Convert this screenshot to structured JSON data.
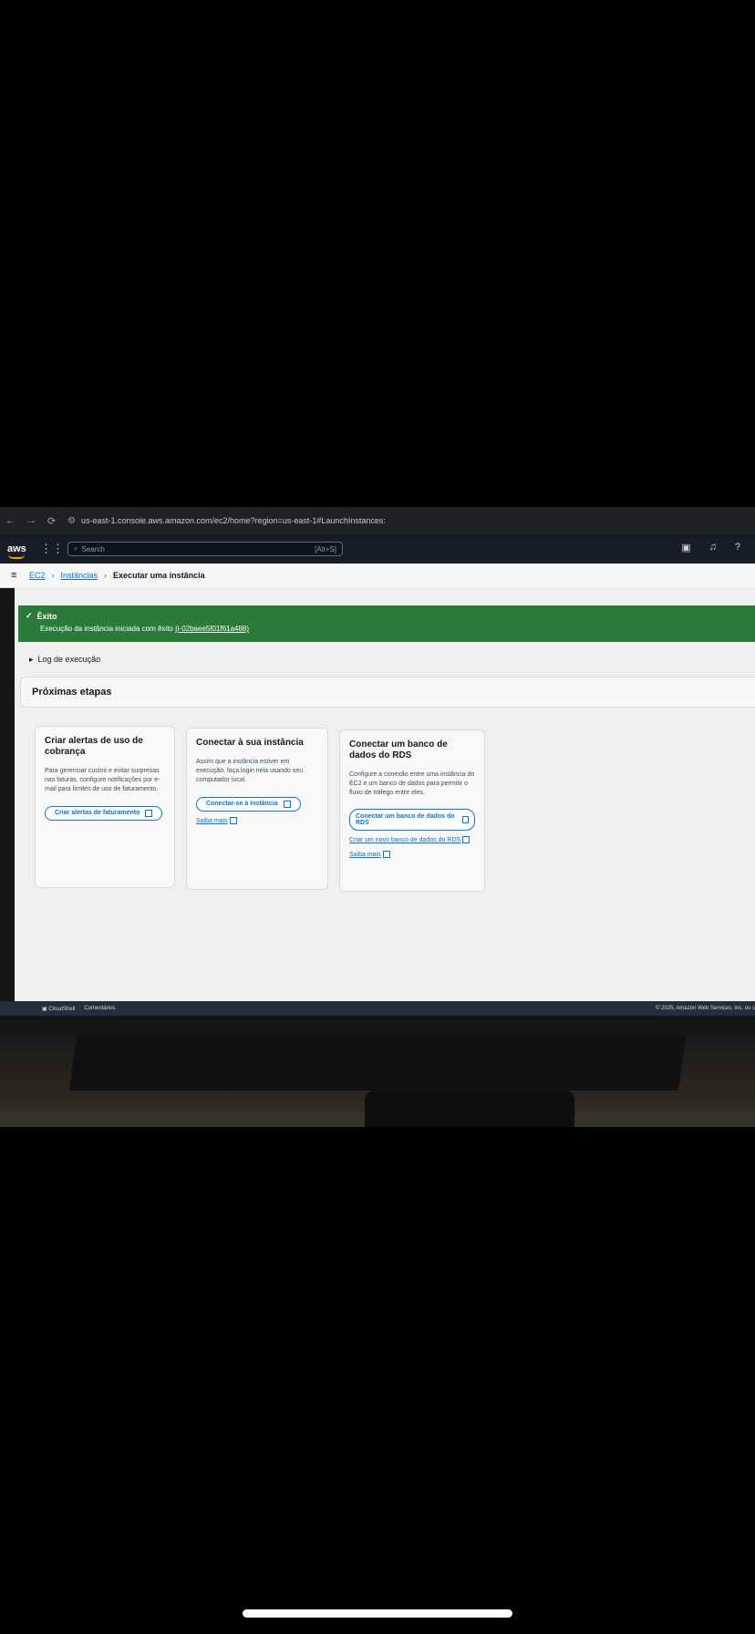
{
  "browser": {
    "url": "us-east-1.console.aws.amazon.com/ec2/home?region=us-east-1#LaunchInstances:"
  },
  "aws": {
    "logo": "aws",
    "search_placeholder": "Search",
    "search_shortcut": "[Alt+S]"
  },
  "breadcrumb": {
    "items": [
      "EC2",
      "Instâncias"
    ],
    "current": "Executar uma instância"
  },
  "flash": {
    "title": "Êxito",
    "message_prefix": "Execução da instância iniciada com êxito ",
    "instance_link": "(i-02baee5f01f61a488)"
  },
  "log": {
    "label": "Log de execução"
  },
  "next_steps": {
    "title": "Próximas etapas"
  },
  "cards": [
    {
      "title": "Criar alertas de uso de cobrança",
      "body": "Para gerenciar custos e evitar surpresas nas faturas, configure notificações por e-mail para limites de uso de faturamento.",
      "button": "Criar alertas de faturamento"
    },
    {
      "title": "Conectar à sua instância",
      "body": "Assim que a instância estiver em execução, faça login nela usando seu computador local.",
      "button": "Conectar-se à instância",
      "link": "Saiba mais"
    },
    {
      "title": "Conectar um banco de dados do RDS",
      "body": "Configure a conexão entre uma instância do EC2 e um banco de dados para permitir o fluxo de tráfego entre eles.",
      "button": "Conectar um banco de dados do RDS",
      "link1": "Criar um novo banco de dados do RDS",
      "link2": "Saiba mais"
    }
  ],
  "footer": {
    "cloudshell": "CloudShell",
    "feedback": "Comentários",
    "copyright": "© 2025, Amazon Web Services, Inc. ou s"
  }
}
